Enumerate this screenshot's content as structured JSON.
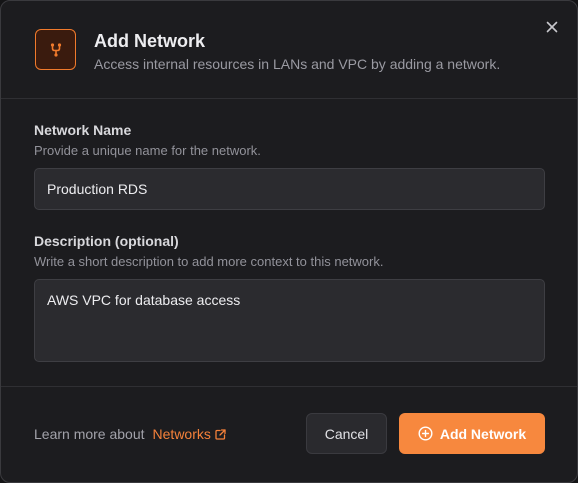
{
  "dialog": {
    "title": "Add Network",
    "subtitle": "Access internal resources in LANs and VPC by adding a network.",
    "header_icon": "network-branch-icon",
    "close_icon": "close-icon"
  },
  "form": {
    "name": {
      "label": "Network Name",
      "hint": "Provide a unique name for the network.",
      "value": "Production RDS"
    },
    "description": {
      "label": "Description (optional)",
      "hint": "Write a short description to add more context to this network.",
      "value": "AWS VPC for database access"
    }
  },
  "footer": {
    "learn_text": "Learn more about",
    "learn_link": "Networks",
    "cancel_label": "Cancel",
    "add_label": "Add Network"
  },
  "colors": {
    "accent": "#f7883e",
    "background": "#1c1c1f",
    "input_bg": "#2b2b2f"
  }
}
